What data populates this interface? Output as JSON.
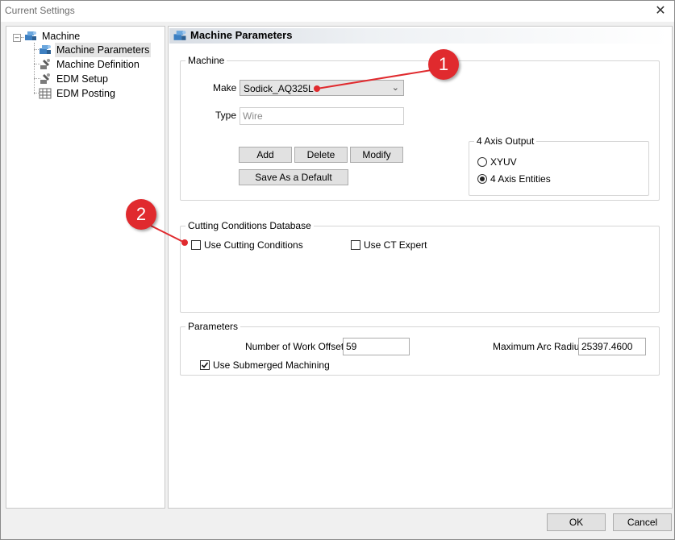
{
  "window": {
    "title": "Current Settings",
    "close": "✕"
  },
  "tree": {
    "root": {
      "label": "Machine",
      "expander": "–"
    },
    "items": [
      {
        "label": "Machine Parameters",
        "icon": "machine-icon"
      },
      {
        "label": "Machine Definition",
        "icon": "wrench-icon"
      },
      {
        "label": "EDM Setup",
        "icon": "wrench-icon"
      },
      {
        "label": "EDM Posting",
        "icon": "grid-icon"
      }
    ]
  },
  "header": {
    "title": "Machine Parameters",
    "icon": "machine-icon"
  },
  "machine": {
    "legend": "Machine",
    "make_label": "Make",
    "make_value": "Sodick_AQ325L",
    "type_label": "Type",
    "type_placeholder": "Wire",
    "add": "Add",
    "delete": "Delete",
    "modify": "Modify",
    "save_default": "Save As a Default"
  },
  "axis_output": {
    "legend": "4 Axis Output",
    "opt1": "XYUV",
    "opt2": "4 Axis Entities",
    "selected": "4 Axis Entities"
  },
  "cutting": {
    "legend": "Cutting Conditions Database",
    "use_cutting": "Use Cutting Conditions",
    "use_ct": "Use CT Expert",
    "use_cutting_checked": false,
    "use_ct_checked": false
  },
  "parameters": {
    "legend": "Parameters",
    "work_offsets_label": "Number of Work Offsets",
    "work_offsets_value": "59",
    "max_arc_label": "Maximum Arc Radius",
    "max_arc_value": "25397.4600",
    "submerged": "Use Submerged Machining",
    "submerged_checked": true
  },
  "callouts": {
    "one": "1",
    "two": "2"
  },
  "footer": {
    "ok": "OK",
    "cancel": "Cancel"
  },
  "colors": {
    "callout": "#e02a2e",
    "selection": "#e5e5e5"
  }
}
